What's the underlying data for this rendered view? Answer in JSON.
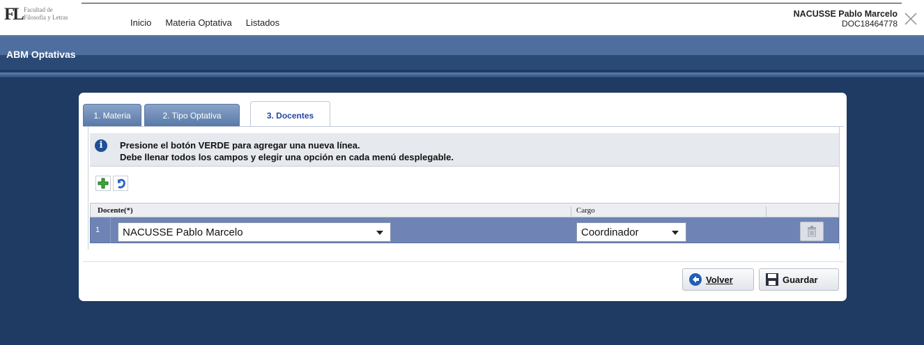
{
  "logo": {
    "text_line1": "Facultad de",
    "text_line2": "Filosofía y Letras"
  },
  "nav": {
    "items": [
      "Inicio",
      "Materia Optativa",
      "Listados"
    ]
  },
  "user": {
    "name": "NACUSSE Pablo Marcelo",
    "id": "DOC18464778"
  },
  "header": {
    "title": "ABM Optativas"
  },
  "tabs": [
    {
      "label": "1. Materia",
      "active": false
    },
    {
      "label": "2. Tipo Optativa",
      "active": false
    },
    {
      "label": "3. Docentes",
      "active": true
    }
  ],
  "info": {
    "line1": "Presione el botón VERDE para agregar una nueva línea.",
    "line2": "Debe llenar todos los campos y elegir una opción en cada menú desplegable."
  },
  "toolbar": {
    "add_icon": "green-plus-icon",
    "undo_icon": "undo-icon"
  },
  "grid": {
    "columns": [
      "Docente(*)",
      "Cargo",
      ""
    ],
    "rows": [
      {
        "num": "1",
        "docente": "NACUSSE Pablo Marcelo",
        "cargo": "Coordinador"
      }
    ]
  },
  "buttons": {
    "volver": "Volver",
    "guardar": "Guardar"
  },
  "colors": {
    "background": "#1f3b63",
    "header_band": "#4f6ea0",
    "row_selected": "#6f84b5",
    "active_tab_text": "#2448a0"
  }
}
